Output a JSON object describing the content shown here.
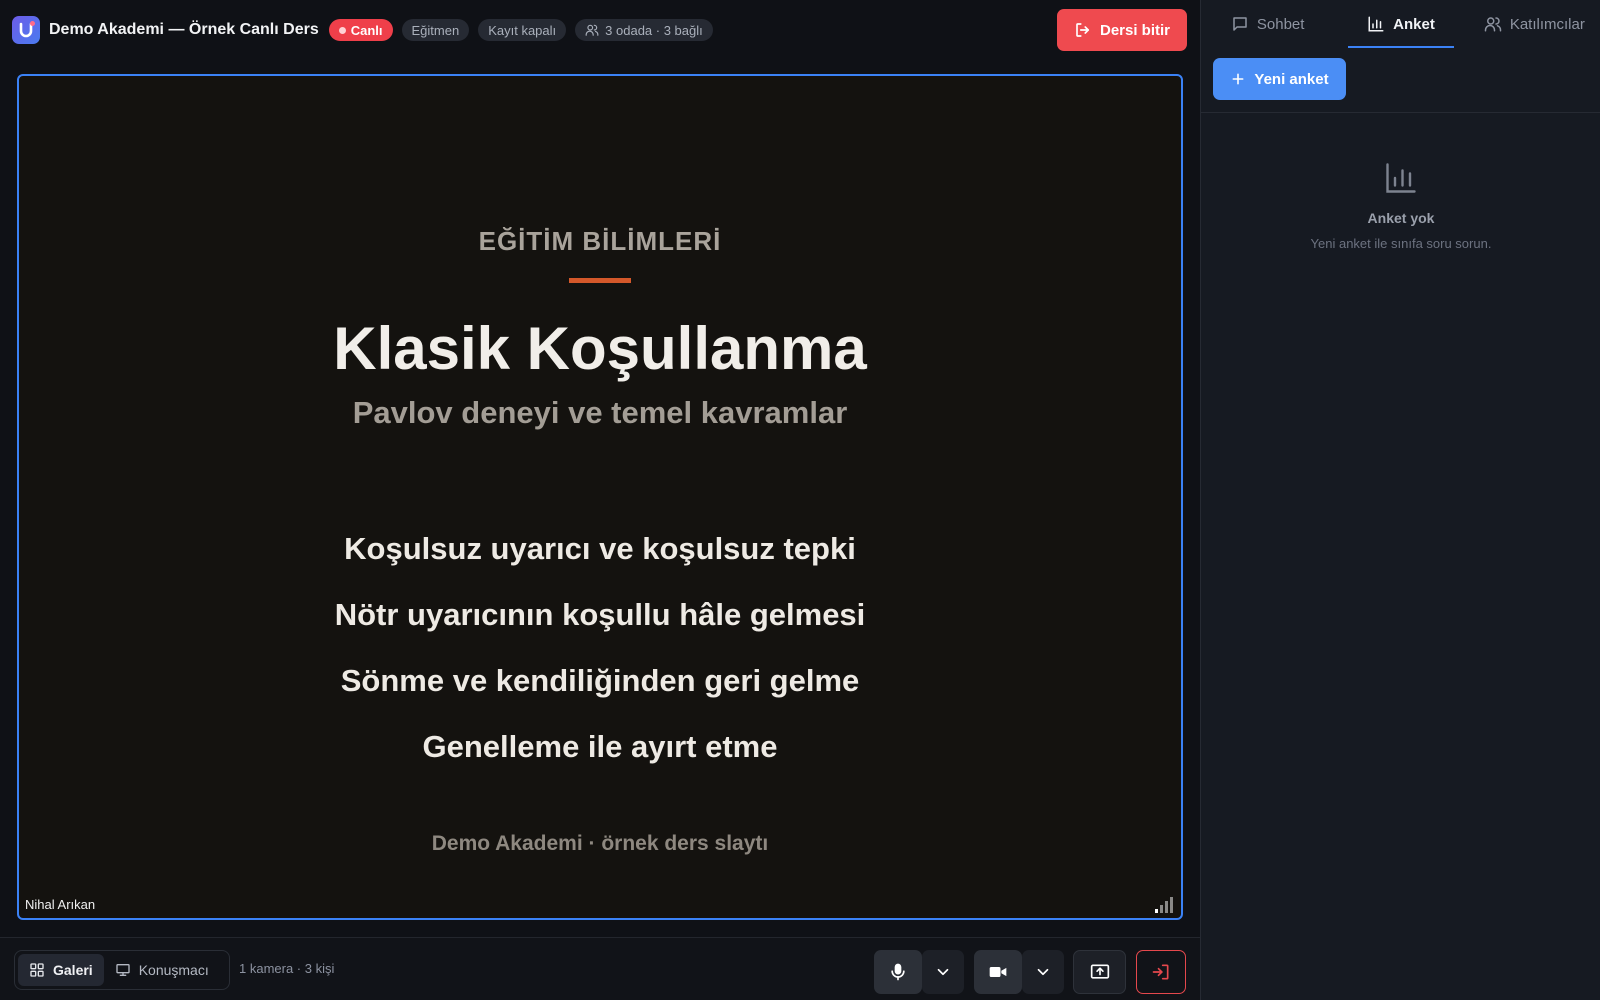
{
  "header": {
    "title": "Demo Akademi — Örnek Canlı Ders",
    "badges": {
      "live": "Canlı",
      "role": "Eğitmen",
      "recording": "Kayıt kapalı",
      "participants": "3 odada · 3 bağlı"
    },
    "end_button": "Dersi bitir"
  },
  "stage": {
    "slide": {
      "kicker": "EĞİTİM BİLİMLERİ",
      "title": "Klasik Koşullanma",
      "subtitle": "Pavlov deneyi ve temel kavramlar",
      "bullets": [
        "Koşulsuz uyarıcı ve koşulsuz tepki",
        "Nötr uyarıcının koşullu hâle gelmesi",
        "Sönme ve kendiliğinden geri gelme",
        "Genelleme ile ayırt etme"
      ],
      "footer": "Demo Akademi · örnek ders slaytı"
    },
    "speaker_name": "Nihal Arıkan"
  },
  "bottombar": {
    "views": {
      "gallery": "Galeri",
      "speaker": "Konuşmacı"
    },
    "camera_count": "1 kamera · 3 kişi"
  },
  "sidebar": {
    "tabs": {
      "chat": "Sohbet",
      "poll": "Anket",
      "participants": "Katılımcılar"
    },
    "new_poll_button": "Yeni anket",
    "empty": {
      "title": "Anket yok",
      "description": "Yeni anket ile sınıfa soru sorun."
    }
  },
  "colors": {
    "accent": "#3b82f6",
    "danger": "#ef4a4f",
    "slide_rule": "#d4582a"
  }
}
